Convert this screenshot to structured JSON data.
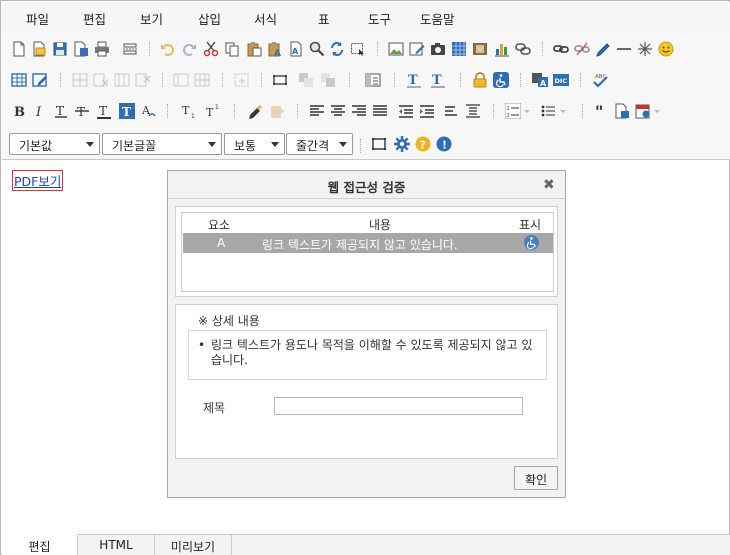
{
  "menubar": {
    "items": [
      "파일",
      "편집",
      "보기",
      "삽입",
      "서식",
      "표",
      "도구",
      "도움말"
    ]
  },
  "format_bar": {
    "style_select": "기본값",
    "font_select": "기본글꼴",
    "size_select": "보통",
    "spacing_select": "줄간격"
  },
  "content": {
    "link_text": "PDF보기"
  },
  "dialog": {
    "title": "웹 접근성 검증",
    "close_glyph": "✖",
    "table": {
      "headers": [
        "요소",
        "내용",
        "표시"
      ],
      "rows": [
        {
          "element": "A",
          "content": "링크 텍스트가 제공되지 않고 있습니다.",
          "mark": "accessibility-icon"
        }
      ]
    },
    "detail_heading": "※ 상세 내용",
    "detail_bullet": "•",
    "detail_text": "링크 텍스트가 용도나 목적을 이해할 수 있도록 제공되지 않고 있습니다.",
    "title_label": "제목",
    "title_value": "",
    "ok_label": "확인"
  },
  "tabs": [
    "편집",
    "HTML",
    "미리보기"
  ],
  "active_tab": "편집",
  "colors": {
    "link": "#1a45c9",
    "link_outline": "#dd3333",
    "selected_row": "#a7a7a7",
    "accessibility_badge": "#4a7ec2",
    "toolbar_blue": "#2f6db5"
  }
}
